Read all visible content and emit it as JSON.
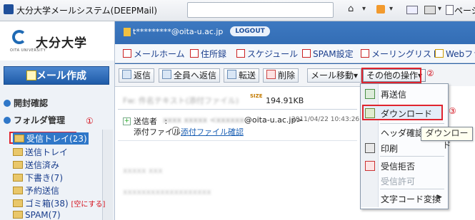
{
  "browser": {
    "window_title": "大分大学メールシステム(DEEPMail)",
    "page_menu": "ページ",
    "toolbar_icons": [
      "home-icon",
      "rss-icon",
      "mail-icon",
      "print-icon",
      "page-icon"
    ]
  },
  "sidebar": {
    "org_name": "大分大学",
    "org_sub": "OITA UNIVERSITY",
    "compose_label": "メール作成",
    "open_confirm": "開封確認",
    "folder_manage": "フォルダ管理",
    "step1": "①",
    "folders": [
      {
        "label": "受信トレイ(23)"
      },
      {
        "label": "送信トレイ"
      },
      {
        "label": "送信済み"
      },
      {
        "label": "下書き(7)"
      },
      {
        "label": "予約送信"
      },
      {
        "label": "ゴミ箱(38)",
        "action": "[空にする]"
      },
      {
        "label": "SPAM(7)"
      }
    ]
  },
  "header": {
    "user_email": "t*********@oita-u.ac.jp",
    "logout": "LOGOUT",
    "nav": [
      {
        "label": "メールホーム"
      },
      {
        "label": "住所録"
      },
      {
        "label": "スケジュール"
      },
      {
        "label": "SPAM設定"
      },
      {
        "label": "メーリングリスト"
      },
      {
        "label": "Webファイ"
      }
    ]
  },
  "toolbar": {
    "reply": "返信",
    "reply_all": "全員へ返信",
    "forward": "転送",
    "delete": "削除",
    "move": "メール移動▾",
    "other_ops": "その他の操作▾",
    "step2": "②"
  },
  "message": {
    "subject_blurred": "Fw: 件名テキスト(添付ファイル)",
    "size_badge": "SIZE",
    "size": "194.91KB",
    "sender_label": "送信者",
    "sender_colon": ":",
    "sender_name_blurred": "xxxx xxxxx <xxxxxx",
    "sender_domain": "@oita-u.ac.jp>",
    "date": "2011/04/22 10:43:26",
    "attach_label": "添付ファイル:",
    "attach_link": "添付ファイル確認",
    "body_lines": [
      "xxxxx xxx",
      "xxxxxxxxxxxxxxxxxxx"
    ]
  },
  "menu": {
    "items": [
      {
        "label": "再送信",
        "enabled": true
      },
      {
        "label": "ダウンロード",
        "enabled": true
      },
      {
        "label": "ヘッダ確認",
        "enabled": true
      },
      {
        "label": "印刷",
        "enabled": true
      },
      {
        "label": "受信拒否",
        "enabled": true
      },
      {
        "label": "受信許可",
        "enabled": false
      },
      {
        "label": "文字コード変換",
        "enabled": true
      }
    ],
    "step3": "③",
    "tooltip": "ダウンロード",
    "submenu_arrow": "▶"
  },
  "colors": {
    "accent": "#2b63aa",
    "highlight": "#e0242e"
  }
}
